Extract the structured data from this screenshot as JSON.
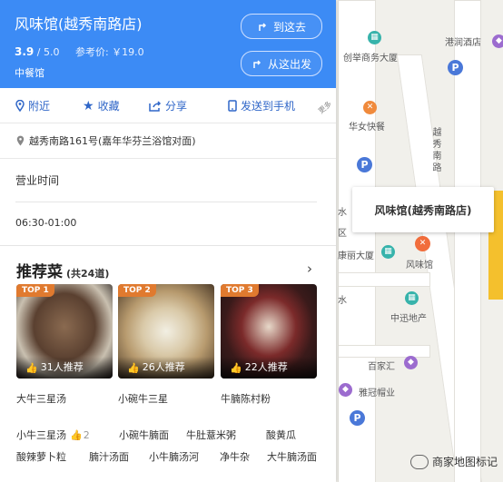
{
  "colors": {
    "header_bg": "#3c8bf5",
    "link_blue": "#2f66c8",
    "rank_orange": "#e07a2f",
    "map_bg": "#f1f0eb"
  },
  "place": {
    "name": "风味馆(越秀南路店)",
    "rating": "3.9",
    "rating_max": "/ 5.0",
    "price_label": "参考价: ￥19.0",
    "category": "中餐馆"
  },
  "header_buttons": {
    "goto": "到这去",
    "from": "从这出发"
  },
  "actions": {
    "nearby": "附近",
    "favorite": "收藏",
    "share": "分享",
    "send": "发送到手机",
    "more": "更多"
  },
  "address": "越秀南路161号(嘉年华芬兰浴馆对面)",
  "hours": {
    "title": "营业时间",
    "value": "06:30-01:00"
  },
  "recommend": {
    "title": "推荐菜",
    "count": "(共24道)",
    "dishes": [
      {
        "rank": "TOP 1",
        "likes": "31人推荐",
        "name": "大牛三星汤"
      },
      {
        "rank": "TOP 2",
        "likes": "26人推荐",
        "name": "小碗牛三星"
      },
      {
        "rank": "TOP 3",
        "likes": "22人推荐",
        "name": "牛腩陈村粉"
      }
    ],
    "tags_row1": [
      {
        "name": "小牛三星汤",
        "likes": "2"
      },
      {
        "name": "小碗牛腩面"
      },
      {
        "name": "牛肚薏米粥"
      },
      {
        "name": "酸黄瓜"
      }
    ],
    "tags_row2": [
      {
        "name": "酸辣萝卜粒"
      },
      {
        "name": "腩汁汤面"
      },
      {
        "name": "小牛腩汤河"
      },
      {
        "name": "净牛杂"
      },
      {
        "name": "大牛腩汤面"
      }
    ]
  },
  "map": {
    "labels": {
      "ganglun": "港润酒店",
      "chuangju": "创举商务大厦",
      "huanv": "华女快餐",
      "yuexiu": "越秀南路",
      "shui1": "水",
      "qu": "区",
      "kangli": "康丽大厦",
      "fengweiguan": "风味馆",
      "shui2": "水",
      "zhongxun": "中迅地产",
      "baijiahui": "百家汇",
      "yaguan": "雅冠帽业"
    },
    "callout": "风味馆(越秀南路店)",
    "watermark": "商家地图标记"
  }
}
